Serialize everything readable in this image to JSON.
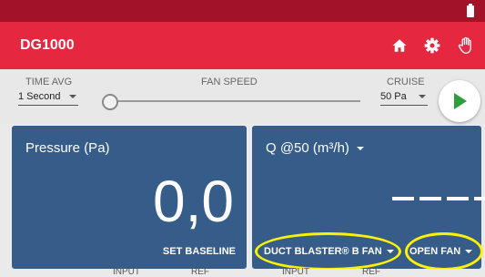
{
  "app": {
    "title": "DG1000"
  },
  "controls": {
    "time_avg": {
      "label": "TIME AVG",
      "value": "1 Second"
    },
    "fan_speed": {
      "label": "FAN SPEED",
      "level": 0
    },
    "cruise": {
      "label": "CRUISE",
      "value": "50 Pa"
    }
  },
  "pressure_card": {
    "title": "Pressure (Pa)",
    "value": "0,0",
    "action": "SET BASELINE"
  },
  "flow_card": {
    "title": "Q @50 (m³/h)",
    "value": "----",
    "device_button": "DUCT BLASTER® B FAN",
    "config_button": "OPEN FAN"
  },
  "bottom_tabs": [
    "INPUT",
    "REF",
    "INPUT",
    "REF"
  ],
  "colors": {
    "status_bar": "#a31328",
    "app_bar": "#e5273f",
    "card": "#365c8a",
    "play": "#2e9e3e",
    "highlight": "#fff200"
  },
  "icons": [
    "battery-icon",
    "home-icon",
    "gear-icon",
    "hand-icon",
    "play-icon",
    "chevron-down-icon"
  ]
}
